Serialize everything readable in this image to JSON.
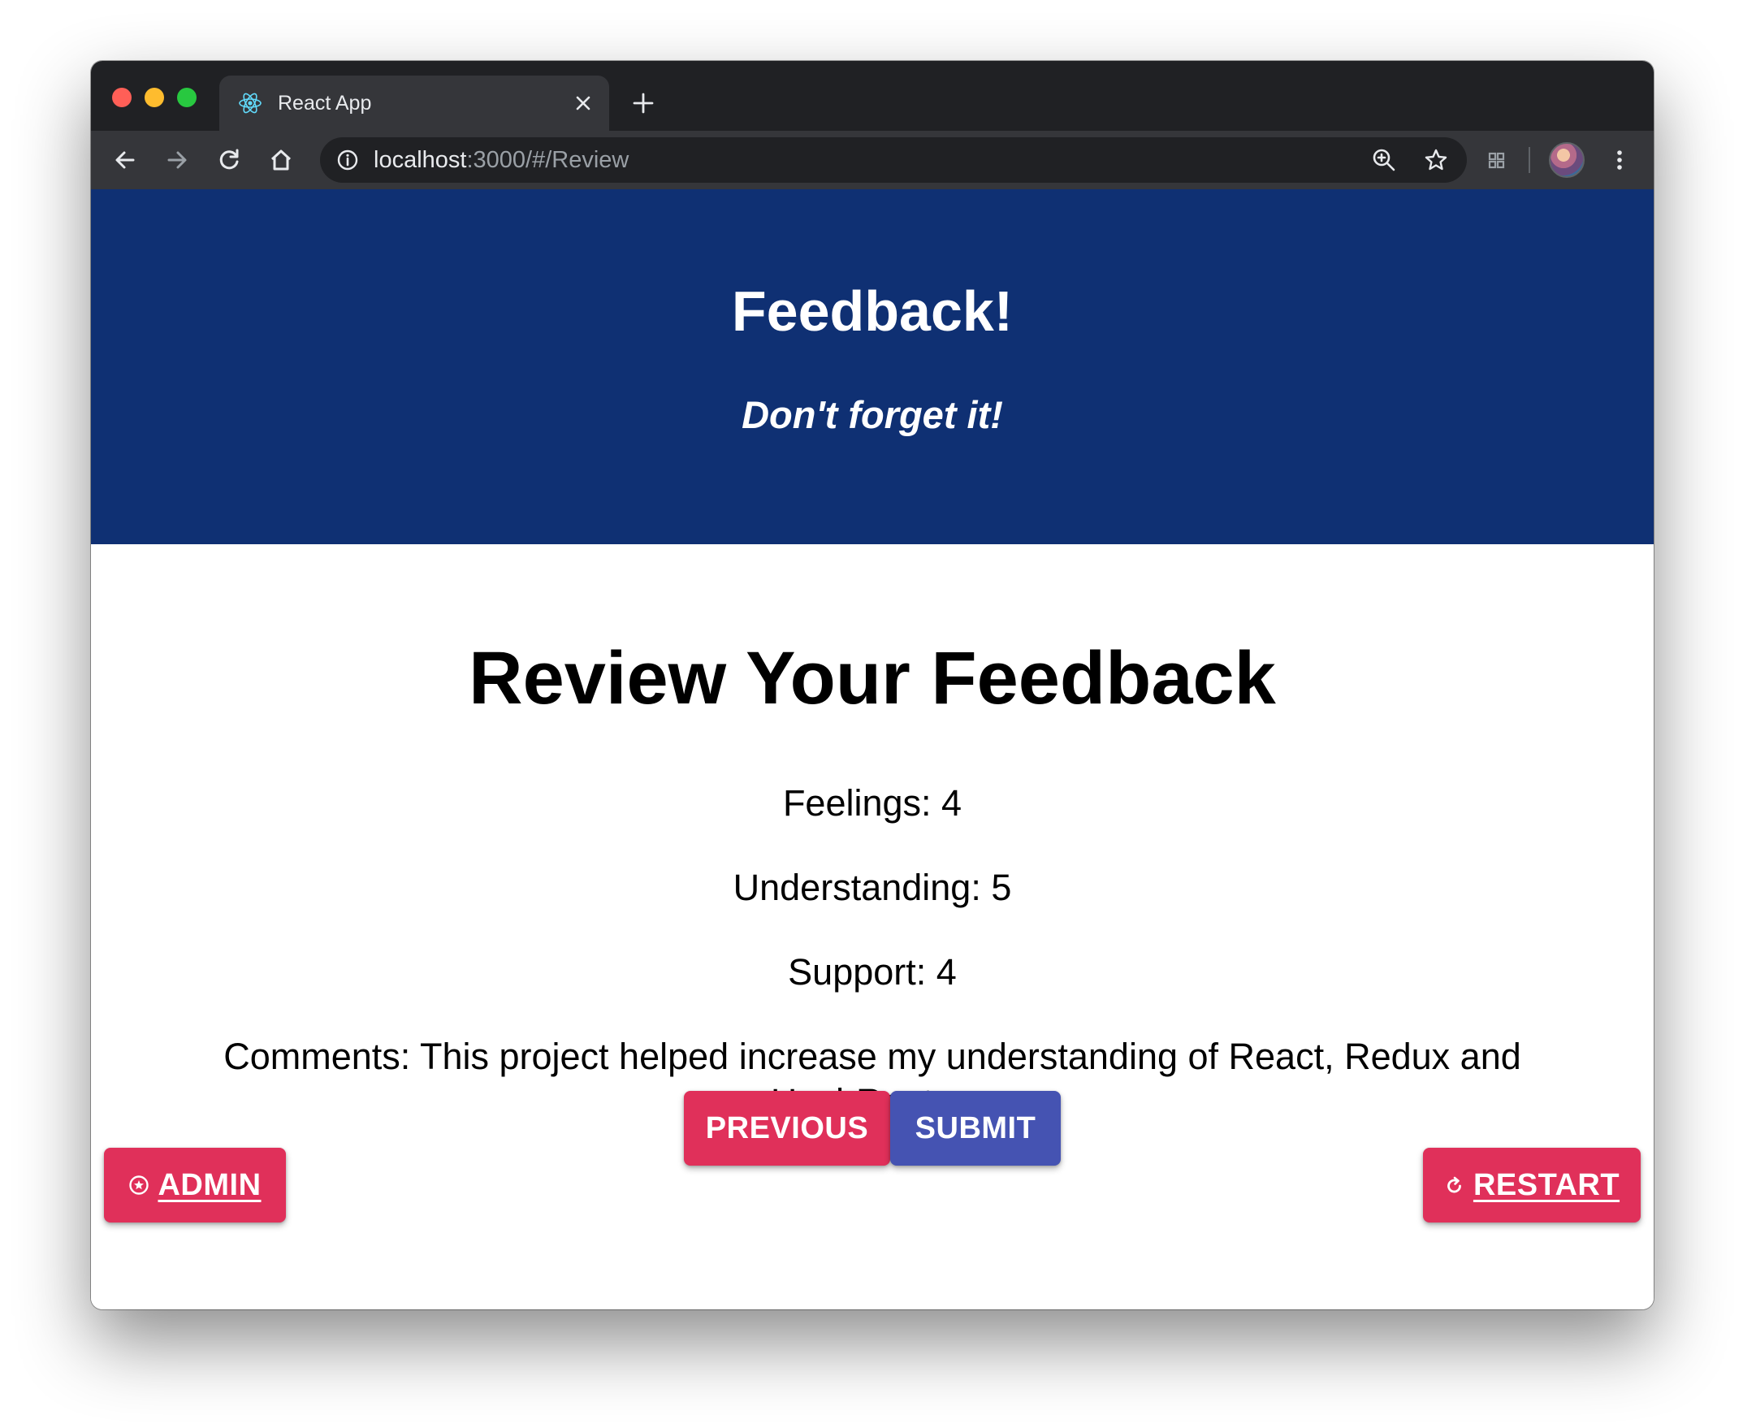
{
  "browser": {
    "tab_title": "React App",
    "url_host": "localhost",
    "url_path": ":3000/#/Review"
  },
  "icons": {
    "favicon": "react-atom-icon",
    "close": "close-icon",
    "new_tab": "plus-icon",
    "back": "back-arrow-icon",
    "forward": "forward-arrow-icon",
    "reload": "reload-icon",
    "home": "home-icon",
    "info": "info-icon",
    "zoom": "zoom-icon",
    "bookmark": "star-icon",
    "extensions": "grid-icon",
    "menu": "kebab-menu-icon",
    "admin": "star-circle-icon",
    "restart": "restart-icon"
  },
  "header": {
    "title": "Feedback!",
    "subtitle": "Don't forget it!"
  },
  "review": {
    "title": "Review Your Feedback",
    "feelings": "Feelings: 4",
    "understanding": "Understanding: 5",
    "support": "Support: 4",
    "comments": "Comments: This project helped increase my understanding of React, Redux and HashRouter."
  },
  "buttons": {
    "previous": "PREVIOUS",
    "submit": "SUBMIT",
    "admin": "ADMIN",
    "restart": "RESTART"
  },
  "colors": {
    "header_bg": "#0f3073",
    "secondary": "#e0305a",
    "primary": "#4553b2"
  }
}
